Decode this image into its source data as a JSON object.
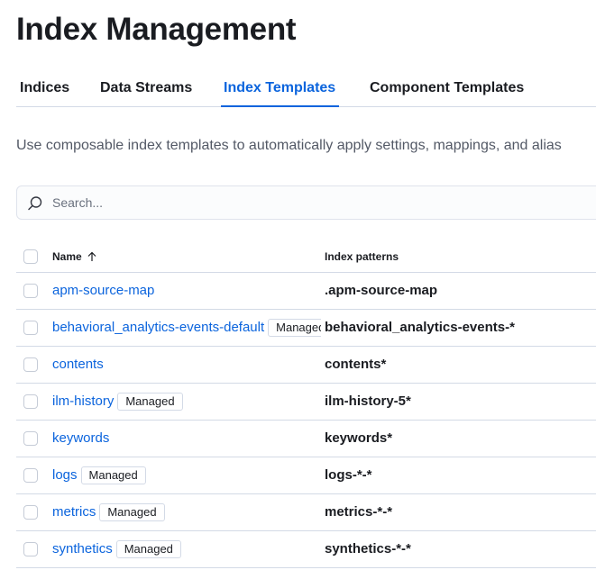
{
  "page": {
    "title": "Index Management"
  },
  "tabs": [
    {
      "label": "Indices"
    },
    {
      "label": "Data Streams"
    },
    {
      "label": "Index Templates"
    },
    {
      "label": "Component Templates"
    }
  ],
  "description": "Use composable index templates to automatically apply settings, mappings, and alias",
  "search": {
    "placeholder": "Search..."
  },
  "table": {
    "columns": {
      "name": "Name",
      "index_patterns": "Index patterns"
    },
    "sort": {
      "column": "name",
      "direction": "ascending"
    },
    "rows": [
      {
        "name": "apm-source-map",
        "badge": "",
        "pattern": ".apm-source-map"
      },
      {
        "name": "behavioral_analytics-events-default",
        "badge": "Managed",
        "pattern": "behavioral_analytics-events-*"
      },
      {
        "name": "contents",
        "badge": "",
        "pattern": "contents*"
      },
      {
        "name": "ilm-history",
        "badge": "Managed",
        "pattern": "ilm-history-5*"
      },
      {
        "name": "keywords",
        "badge": "",
        "pattern": "keywords*"
      },
      {
        "name": "logs",
        "badge": "Managed",
        "pattern": "logs-*-*"
      },
      {
        "name": "metrics",
        "badge": "Managed",
        "pattern": "metrics-*-*"
      },
      {
        "name": "synthetics",
        "badge": "Managed",
        "pattern": "synthetics-*-*"
      }
    ]
  },
  "colors": {
    "accent": "#0b64dd",
    "text": "#1a1c21",
    "border": "#d3dae6"
  },
  "icons": {
    "search": "search-icon",
    "sort": "arrow-up-icon"
  }
}
